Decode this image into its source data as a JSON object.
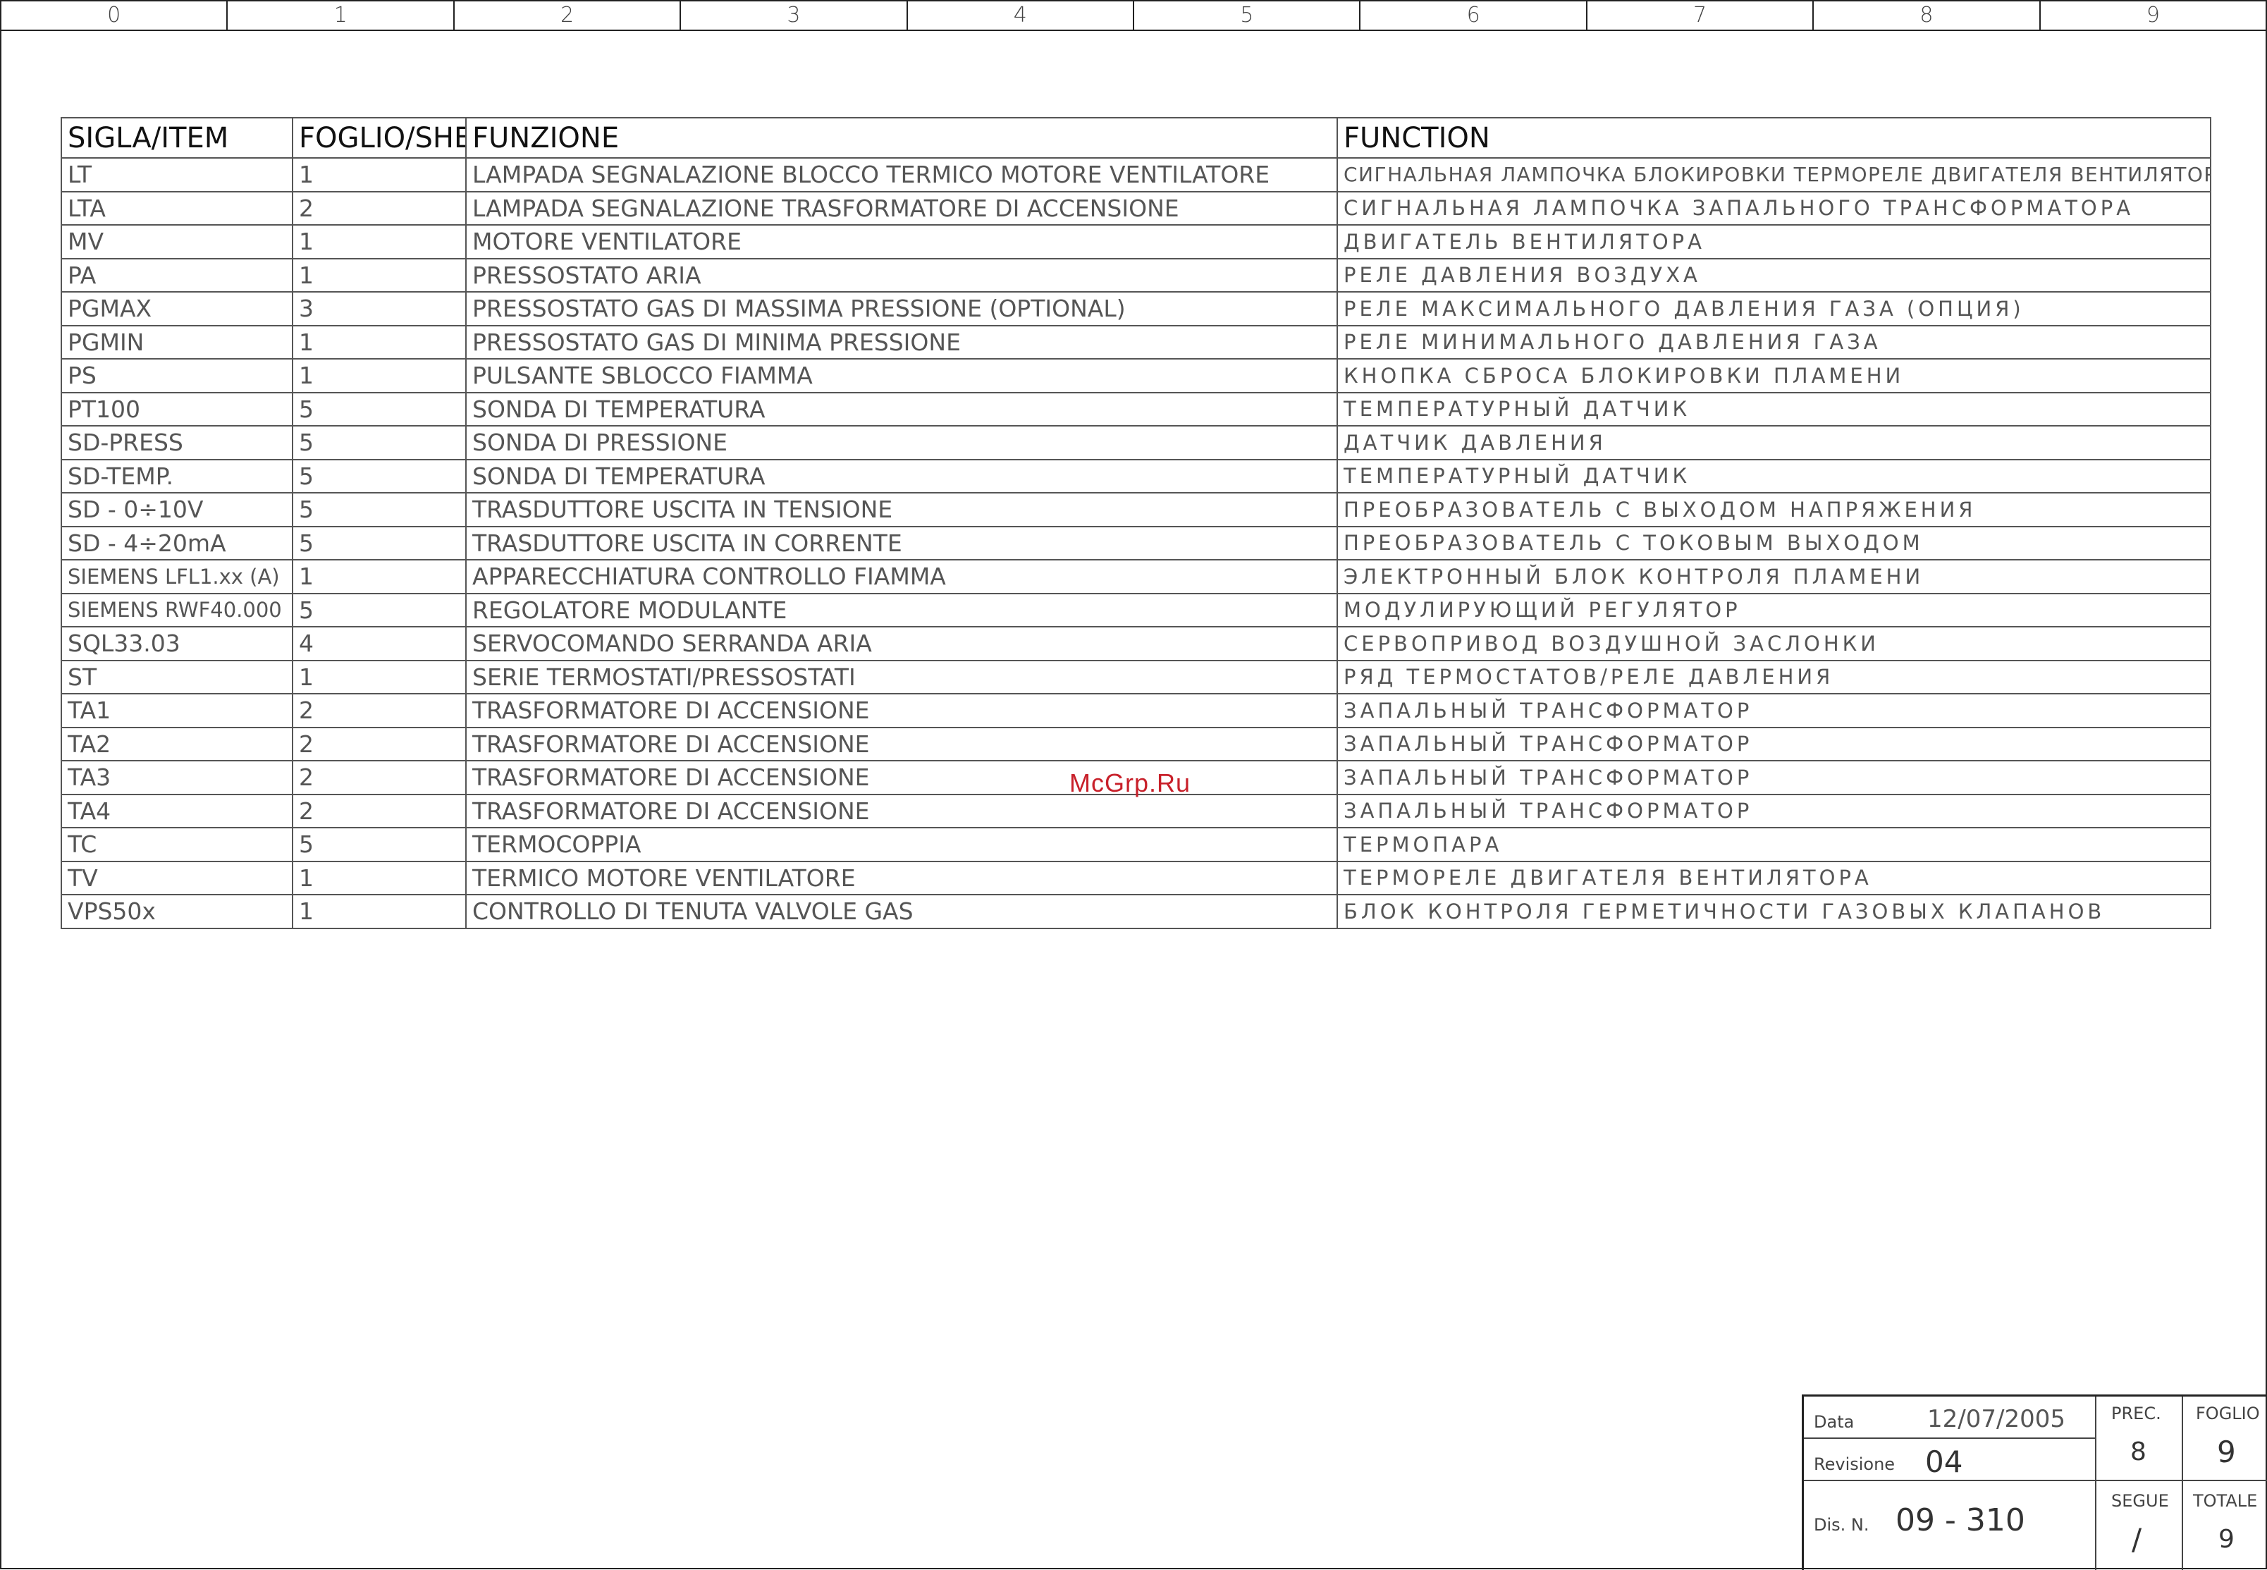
{
  "ruler": [
    "0",
    "1",
    "2",
    "3",
    "4",
    "5",
    "6",
    "7",
    "8",
    "9"
  ],
  "table": {
    "headers": [
      "SIGLA/ITEM",
      "FOGLIO/SHEET",
      "FUNZIONE",
      "FUNCTION"
    ],
    "rows": [
      [
        "LT",
        "1",
        "LAMPADA SEGNALAZIONE BLOCCO TERMICO MOTORE VENTILATORE",
        "СИГНАЛЬНАЯ ЛАМПОЧКА  БЛОКИРОВКИ ТЕРМОРЕЛЕ ДВИГАТЕЛЯ ВЕНТИЛЯТОРА"
      ],
      [
        "LTA",
        "2",
        "LAMPADA SEGNALAZIONE TRASFORMATORE DI ACCENSIONE",
        "СИГНАЛЬНАЯ ЛАМПОЧКА ЗАПАЛЬНОГО ТРАНСФОРМАТОРА"
      ],
      [
        "MV",
        "1",
        "MOTORE VENTILATORE",
        "ДВИГАТЕЛЬ ВЕНТИЛЯТОРА"
      ],
      [
        "PA",
        "1",
        "PRESSOSTATO ARIA",
        "РЕЛЕ ДАВЛЕНИЯ ВОЗДУХА"
      ],
      [
        "PGMAX",
        "3",
        "PRESSOSTATO GAS DI MASSIMA PRESSIONE (OPTIONAL)",
        "РЕЛЕ МАКСИМАЛЬНОГО ДАВЛЕНИЯ ГАЗА  (ОПЦИЯ)"
      ],
      [
        "PGMIN",
        "1",
        "PRESSOSTATO GAS DI MINIMA PRESSIONE",
        "РЕЛЕ МИНИМАЛЬНОГО ДАВЛЕНИЯ ГАЗА"
      ],
      [
        "PS",
        "1",
        "PULSANTE SBLOCCO FIAMMA",
        "КНОПКА СБРОСА БЛОКИРОВКИ ПЛАМЕНИ"
      ],
      [
        "PT100",
        "5",
        "SONDA DI TEMPERATURA",
        "ТЕМПЕРАТУРНЫЙ ДАТЧИК"
      ],
      [
        "SD-PRESS",
        "5",
        "SONDA DI PRESSIONE",
        "ДАТЧИК ДАВЛЕНИЯ"
      ],
      [
        "SD-TEMP.",
        "5",
        "SONDA DI TEMPERATURA",
        "ТЕМПЕРАТУРНЫЙ ДАТЧИК"
      ],
      [
        "SD - 0÷10V",
        "5",
        "TRASDUTTORE USCITA IN TENSIONE",
        "ПРЕОБРАЗОВАТЕЛЬ С ВЫХОДОМ НАПРЯЖЕНИЯ"
      ],
      [
        "SD - 4÷20mA",
        "5",
        "TRASDUTTORE USCITA IN CORRENTE",
        "ПРЕОБРАЗОВАТЕЛЬ С ТОКОВЫМ ВЫХОДОМ"
      ],
      [
        "SIEMENS LFL1.xx (A)",
        "1",
        "APPARECCHIATURA CONTROLLO FIAMMA",
        "ЭЛЕКТРОННЫЙ БЛОК КОНТРОЛЯ ПЛАМЕНИ"
      ],
      [
        "SIEMENS RWF40.000",
        "5",
        "REGOLATORE MODULANTE",
        "МОДУЛИРУЮЩИЙ РЕГУЛЯТОР"
      ],
      [
        "SQL33.03",
        "4",
        "SERVOCOMANDO SERRANDA ARIA",
        "СЕРВОПРИВОД  ВОЗДУШНОЙ ЗАСЛОНКИ"
      ],
      [
        "ST",
        "1",
        "SERIE TERMOSTATI/PRESSOSTATI",
        "РЯД ТЕРМОСТАТОВ/РЕЛЕ ДАВЛЕНИЯ"
      ],
      [
        "TA1",
        "2",
        "TRASFORMATORE DI ACCENSIONE",
        "ЗАПАЛЬНЫЙ ТРАНСФОРМАТОР"
      ],
      [
        "TA2",
        "2",
        "TRASFORMATORE DI ACCENSIONE",
        "ЗАПАЛЬНЫЙ ТРАНСФОРМАТОР"
      ],
      [
        "TA3",
        "2",
        "TRASFORMATORE DI ACCENSIONE",
        "ЗАПАЛЬНЫЙ ТРАНСФОРМАТОР"
      ],
      [
        "TA4",
        "2",
        "TRASFORMATORE DI ACCENSIONE",
        "ЗАПАЛЬНЫЙ ТРАНСФОРМАТОР"
      ],
      [
        "TC",
        "5",
        "TERMOCOPPIA",
        "ТЕРМОПАРА"
      ],
      [
        "TV",
        "1",
        "TERMICO MOTORE VENTILATORE",
        "ТЕРМОРЕЛЕ ДВИГАТЕЛЯ ВЕНТИЛЯТОРА"
      ],
      [
        "VPS50x",
        "1",
        "CONTROLLO DI TENUTA VALVOLE GAS",
        "БЛОК КОНТРОЛЯ ГЕРМЕТИЧНОСТИ ГАЗОВЫХ КЛАПАНОВ"
      ]
    ]
  },
  "watermark": "McGrp.Ru",
  "title_block": {
    "data_label": "Data",
    "data_value": "12/07/2005",
    "revisione_label": "Revisione",
    "revisione_value": "04",
    "dis_label": "Dis. N.",
    "dis_value": "09 - 310",
    "prec_label": "PREC.",
    "prec_value": "8",
    "foglio_label": "FOGLIO",
    "foglio_value": "9",
    "segue_label": "SEGUE",
    "segue_value": "/",
    "totale_label": "TOTALE",
    "totale_value": "9"
  },
  "colors": {
    "watermark": "#c8202a",
    "lines": "#555555"
  }
}
